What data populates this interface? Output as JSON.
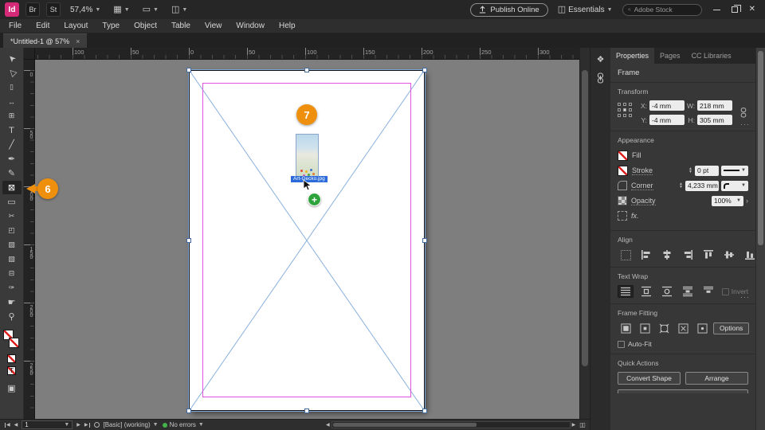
{
  "titlebar": {
    "logo": "Id",
    "bridge": "Br",
    "stock": "St",
    "zoom": "57,4%",
    "publish_online": "Publish Online",
    "workspace": "Essentials",
    "search_placeholder": "Adobe Stock",
    "close": "✕"
  },
  "menubar": {
    "items": [
      "File",
      "Edit",
      "Layout",
      "Type",
      "Object",
      "Table",
      "View",
      "Window",
      "Help"
    ]
  },
  "document_tab": {
    "title": "*Untitled-1 @ 57%",
    "close": "×"
  },
  "rulers": {
    "h": [
      "100",
      "50",
      "0",
      "50",
      "100",
      "150",
      "200",
      "250",
      "300"
    ],
    "v": [
      "0",
      "50",
      "100",
      "150",
      "200",
      "250"
    ]
  },
  "tools": [
    {
      "n": "selection-tool",
      "g": "➤"
    },
    {
      "n": "direct-selection-tool",
      "g": "▷"
    },
    {
      "n": "page-tool",
      "g": "▯"
    },
    {
      "n": "gap-tool",
      "g": "↔"
    },
    {
      "n": "content-collector-tool",
      "g": "⊞"
    },
    {
      "n": "type-tool",
      "g": "T"
    },
    {
      "n": "line-tool",
      "g": "╱"
    },
    {
      "n": "pen-tool",
      "g": "✒"
    },
    {
      "n": "pencil-tool",
      "g": "✎"
    },
    {
      "n": "rectangle-frame-tool",
      "g": "⊠"
    },
    {
      "n": "rectangle-tool",
      "g": "▭"
    },
    {
      "n": "scissors-tool",
      "g": "✂"
    },
    {
      "n": "free-transform-tool",
      "g": "◰"
    },
    {
      "n": "gradient-swatch-tool",
      "g": "▨"
    },
    {
      "n": "gradient-feather-tool",
      "g": "▧"
    },
    {
      "n": "note-tool",
      "g": "⊟"
    },
    {
      "n": "eyedropper-tool",
      "g": "✑"
    },
    {
      "n": "hand-tool",
      "g": "☛"
    },
    {
      "n": "zoom-tool",
      "g": "⚲"
    }
  ],
  "canvas": {
    "badge_6": "6",
    "badge_7": "7",
    "file_label": "Art-Gecko.jpg",
    "plus": "+"
  },
  "panel": {
    "tabs": {
      "properties": "Properties",
      "pages": "Pages",
      "cc_libraries": "CC Libraries"
    },
    "object_type": "Frame",
    "transform": {
      "title": "Transform",
      "x_label": "X:",
      "x_value": "-4 mm",
      "y_label": "Y:",
      "y_value": "-4 mm",
      "w_label": "W:",
      "w_value": "218 mm",
      "h_label": "H:",
      "h_value": "305 mm",
      "more": "···"
    },
    "appearance": {
      "title": "Appearance",
      "fill_label": "Fill",
      "stroke_label": "Stroke",
      "stroke_weight": "0 pt",
      "corner_label": "Corner",
      "corner_value": "4,233 mm",
      "opacity_label": "Opacity",
      "opacity_value": "100%",
      "fx_label": "fx."
    },
    "align": {
      "title": "Align"
    },
    "text_wrap": {
      "title": "Text Wrap",
      "invert_label": "Invert",
      "more": "···"
    },
    "frame_fitting": {
      "title": "Frame Fitting",
      "options_label": "Options",
      "autofit_label": "Auto-Fit"
    },
    "quick_actions": {
      "title": "Quick Actions",
      "convert_shape": "Convert Shape",
      "arrange": "Arrange"
    }
  },
  "statusbar": {
    "page": "1",
    "preflight": "[Basic] (working)",
    "errors_label": "No errors"
  }
}
